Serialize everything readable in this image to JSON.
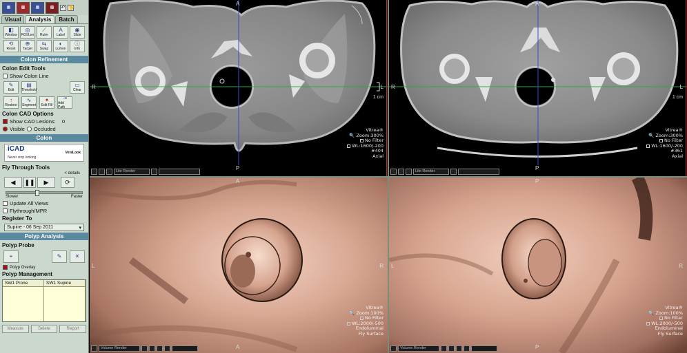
{
  "panel": {
    "tabs": [
      "Visual",
      "Analysis",
      "Batch"
    ],
    "active_tab": "Analysis",
    "tools": [
      "Window",
      "ROI/Len",
      "Ruler",
      "Label",
      "Slide",
      "Reset",
      "Target",
      "Swap",
      "Lumen",
      "Info"
    ],
    "colon_refinement_title": "Colon Refinement",
    "colon_edit_tools_label": "Colon Edit Tools",
    "show_colon_line": "Show Colon Line",
    "edit_buttons": [
      "Edit",
      "Threshold",
      "Clear"
    ],
    "seg_buttons": [
      "Restore",
      "Segment",
      "Edit Fill",
      "Add Path"
    ],
    "colon_cad_options": "Colon CAD Options",
    "show_cad_lesions_label": "Show CAD Lesions:",
    "show_cad_lesions_value": "0",
    "visible_label": "Visible",
    "occluded_label": "Occluded",
    "colon_title": "Colon",
    "icad_logo": "iCAD",
    "icad_sub": "Never stop looking",
    "vera_label": "VeraLook",
    "fly_through_label": "Fly Through Tools",
    "fly_detail": "< details",
    "slower": "Slower",
    "faster": "Faster",
    "update_all_views": "Update All Views",
    "flythrough_mpr": "Flythrough/MPR",
    "register_to": "Register To",
    "register_value": "Supine - 06 Sep 2011",
    "polyp_analysis": "Polyp Analysis",
    "polyp_probe": "Polyp Probe",
    "polyp_overlay": "Polyp Overlay",
    "polyp_management": "Polyp Management",
    "list_cols": [
      "SW1 Prone",
      "SW1 Supine"
    ],
    "bottom_buttons": [
      "Measure",
      "Delete",
      "Report"
    ]
  },
  "views": {
    "tl": {
      "orient_top": "A",
      "orient_left": "R",
      "orient_right": "L",
      "orient_bottom": "P",
      "scale": "1 cm",
      "info": [
        "Vitrea®",
        "Zoom:300%",
        "No Filter",
        "WL:1600/-200",
        "#404",
        "Axial"
      ],
      "toolbar": "Lite Render"
    },
    "tr": {
      "orient_top": "A",
      "orient_left": "R",
      "orient_right": "L",
      "orient_bottom": "P",
      "scale": "1 cm",
      "info": [
        "Vitrea®",
        "Zoom:300%",
        "No Filter",
        "WL:1600/-200",
        "#361",
        "Axial"
      ],
      "toolbar": "Lite Render"
    },
    "bl": {
      "orient_top": "A",
      "orient_left": "L",
      "orient_right": "R",
      "orient_bottom": "A",
      "info": [
        "Vitrea®",
        "Zoom:100%",
        "No Filter",
        "WL:2000/-500",
        "Endoluminal",
        "Fly Surface"
      ],
      "toolbar": "Volume Render"
    },
    "br": {
      "orient_top": "P",
      "orient_left": "L",
      "orient_right": "R",
      "orient_bottom": "P",
      "info": [
        "Vitrea®",
        "Zoom:100%",
        "No Filter",
        "WL:2000/-500",
        "Endoluminal",
        "Fly Surface"
      ],
      "toolbar": "Volume Render"
    }
  }
}
